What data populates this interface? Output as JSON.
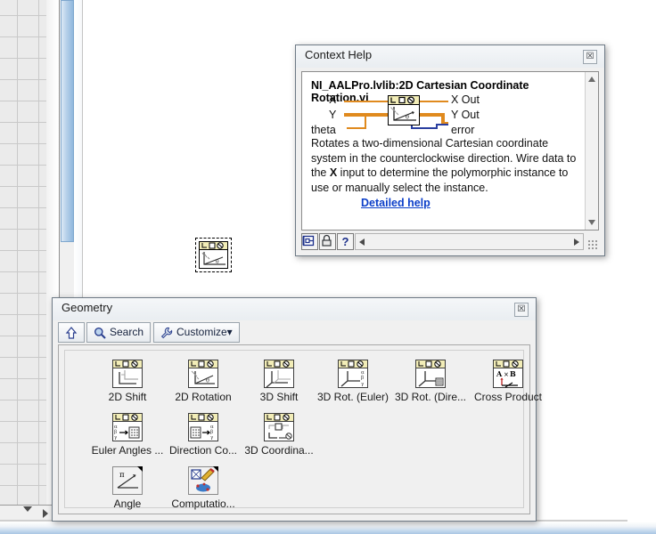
{
  "block_diagram": {
    "name": "block-diagram-canvas",
    "selected_node": "2D Cartesian Coordinate Rotation VI"
  },
  "context_help": {
    "window_title": "Context Help",
    "close_label": "☒",
    "vi_title": "NI_AALPro.lvlib:2D Cartesian Coordinate Rotation.vi",
    "terminals": {
      "inputs": [
        "X",
        "Y",
        "theta"
      ],
      "outputs": [
        "X Out",
        "Y Out",
        "error"
      ]
    },
    "description_part1": "Rotates a two-dimensional Cartesian coordinate system in the counterclockwise direction. Wire data to the ",
    "description_bold": "X",
    "description_part2": " input to determine the polymorphic instance to use or manually select the instance.",
    "detailed_help_link": "Detailed help",
    "toolbar": {
      "show_optional_terminals_label": "⎕",
      "lock_label": "⚿",
      "help_label": "?"
    }
  },
  "geometry_palette": {
    "window_title": "Geometry",
    "close_label": "☒",
    "toolbar": {
      "up_label": "⇧",
      "search_label": "Search",
      "customize_label": "Customize▾"
    },
    "items": [
      {
        "label": "2D Shift",
        "icon": "2d-shift-icon",
        "has_subpalette": false
      },
      {
        "label": "2D Rotation",
        "icon": "2d-rotation-icon",
        "has_subpalette": false
      },
      {
        "label": "3D Shift",
        "icon": "3d-shift-icon",
        "has_subpalette": false
      },
      {
        "label": "3D Rot. (Euler)",
        "icon": "3d-rot-euler-icon",
        "has_subpalette": false
      },
      {
        "label": "3D Rot. (Dire...",
        "icon": "3d-rot-direction-icon",
        "has_subpalette": false
      },
      {
        "label": "Cross Product",
        "icon": "cross-product-icon",
        "has_subpalette": false
      },
      {
        "label": "Euler Angles ...",
        "icon": "euler-angles-icon",
        "has_subpalette": false
      },
      {
        "label": "Direction Co...",
        "icon": "direction-cosines-icon",
        "has_subpalette": false
      },
      {
        "label": "3D Coordina...",
        "icon": "3d-coordinates-icon",
        "has_subpalette": false
      },
      {
        "label": "Angle",
        "icon": "angle-subpalette-icon",
        "has_subpalette": true
      },
      {
        "label": "Computatio...",
        "icon": "computation-subpalette-icon",
        "has_subpalette": true
      }
    ]
  },
  "colors": {
    "vi_icon_banner": "#f2edb7",
    "wire_orange": "#e08a1e",
    "wire_error": "#2a3fa0",
    "link_blue": "#0c3fc9",
    "window_bg": "#f0f0f0"
  }
}
